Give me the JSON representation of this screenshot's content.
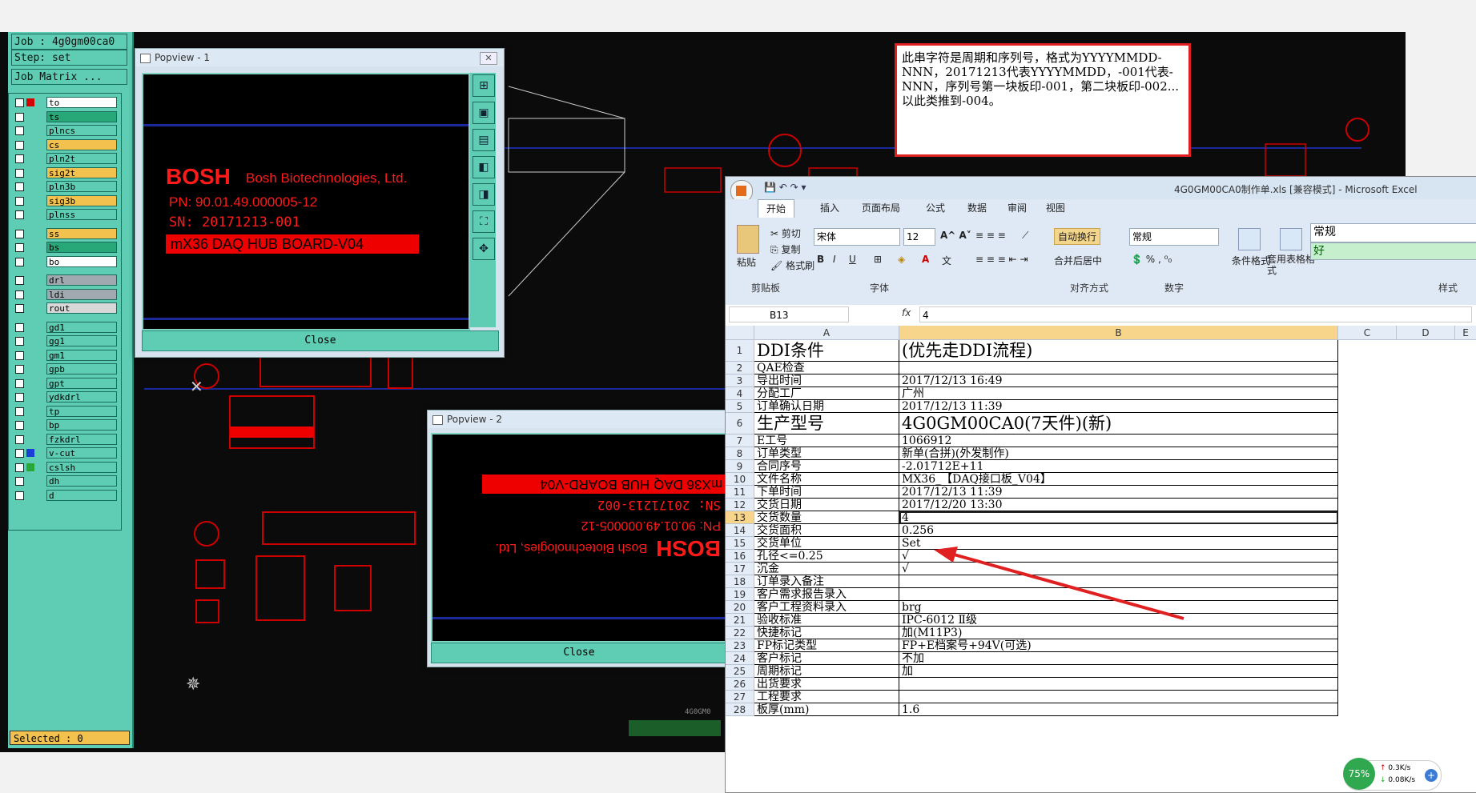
{
  "left_panel": {
    "job": "Job : 4g0gm00ca0",
    "step": "Step: set",
    "job_matrix": "Job Matrix ...",
    "selected": "Selected : 0",
    "layers": [
      {
        "name": "to",
        "color": "#ffffff",
        "swatch": "#d40000"
      },
      {
        "name": "ts",
        "color": "#28a878",
        "swatch": null
      },
      {
        "name": "plncs",
        "color": "#5ecdb3",
        "swatch": null
      },
      {
        "name": "cs",
        "color": "#f2c14e",
        "swatch": null
      },
      {
        "name": "pln2t",
        "color": "#5ecdb3",
        "swatch": null
      },
      {
        "name": "sig2t",
        "color": "#f2c14e",
        "swatch": null
      },
      {
        "name": "pln3b",
        "color": "#5ecdb3",
        "swatch": null
      },
      {
        "name": "sig3b",
        "color": "#f2c14e",
        "swatch": null
      },
      {
        "name": "plnss",
        "color": "#5ecdb3",
        "swatch": null
      },
      {
        "name": "ss",
        "color": "#f2c14e",
        "swatch": null
      },
      {
        "name": "bs",
        "color": "#28a878",
        "swatch": null
      },
      {
        "name": "bo",
        "color": "#ffffff",
        "swatch": null
      },
      {
        "name": "drl",
        "color": "#a0a8b0",
        "swatch": null
      },
      {
        "name": "ldi",
        "color": "#a0a8b0",
        "swatch": null
      },
      {
        "name": "rout",
        "color": "#d8d8d8",
        "swatch": null
      },
      {
        "name": "gd1",
        "color": "#5ecdb3",
        "swatch": null
      },
      {
        "name": "gg1",
        "color": "#5ecdb3",
        "swatch": null
      },
      {
        "name": "gm1",
        "color": "#5ecdb3",
        "swatch": null
      },
      {
        "name": "gpb",
        "color": "#5ecdb3",
        "swatch": null
      },
      {
        "name": "gpt",
        "color": "#5ecdb3",
        "swatch": null
      },
      {
        "name": "ydkdrl",
        "color": "#5ecdb3",
        "swatch": null
      },
      {
        "name": "tp",
        "color": "#5ecdb3",
        "swatch": null
      },
      {
        "name": "bp",
        "color": "#5ecdb3",
        "swatch": null
      },
      {
        "name": "fzkdrl",
        "color": "#5ecdb3",
        "swatch": null
      },
      {
        "name": "v-cut",
        "color": "#5ecdb3",
        "swatch": "#1a3fd4"
      },
      {
        "name": "cslsh",
        "color": "#5ecdb3",
        "swatch": "#28a838"
      },
      {
        "name": "dh",
        "color": "#5ecdb3",
        "swatch": null
      },
      {
        "name": "d",
        "color": "#5ecdb3",
        "swatch": null
      }
    ]
  },
  "popview1": {
    "title": "Popview - 1",
    "close": "Close",
    "brand": "BOSH",
    "company": "Bosh Biotechnologies, Ltd.",
    "pn": "PN: 90.01.49.000005-12",
    "sn": "SN: 20171213-001",
    "board": "mX36 DAQ HUB BOARD-V04"
  },
  "popview2": {
    "title": "Popview - 2",
    "close": "Close",
    "board": "mX36 DAQ HUB BOARD-V04",
    "sn": "SN: 20171213-002",
    "pn": "PN: 90.01.49.000005-12",
    "company": "Bosh Biotechnologies, Ltd.",
    "brand": "BOSH"
  },
  "note": "此串字符是周期和序列号，格式为YYYYMMDD-NNN，20171213代表YYYYMMDD，-001代表-NNN，序列号第一块板印-001，第二块板印-002...以此类推到-004。",
  "excel": {
    "title": "4G0GM00CA0制作单.xls [兼容模式] - Microsoft Excel",
    "tabs": [
      "开始",
      "插入",
      "页面布局",
      "公式",
      "数据",
      "审阅",
      "视图"
    ],
    "clipboard": {
      "paste": "粘贴",
      "cut": "剪切",
      "copy": "复制",
      "format_painter": "格式刷",
      "label": "剪贴板"
    },
    "font": {
      "name": "宋体",
      "size": "12",
      "label": "字体"
    },
    "align": {
      "wrap": "自动换行",
      "merge": "合并后居中",
      "label": "对齐方式"
    },
    "number": {
      "format": "常规",
      "label": "数字"
    },
    "styles": {
      "cond": "条件格式",
      "table": "套用表格格式",
      "normal": "常规",
      "good": "好",
      "label": "样式"
    },
    "namebox": "B13",
    "fx": "fx",
    "formula_value": "4",
    "columns": [
      "A",
      "B",
      "C",
      "D",
      "E"
    ],
    "rows": [
      {
        "n": "1",
        "a": "DDI条件",
        "b": "(优先走DDI流程)",
        "big": true
      },
      {
        "n": "2",
        "a": "QAE检查",
        "b": ""
      },
      {
        "n": "3",
        "a": "导出时间",
        "b": "2017/12/13 16:49"
      },
      {
        "n": "4",
        "a": "分配工厂",
        "b": "广州"
      },
      {
        "n": "5",
        "a": "订单确认日期",
        "b": "2017/12/13 11:39"
      },
      {
        "n": "6",
        "a": "生产型号",
        "b": "4G0GM00CA0(7天件)(新)",
        "big": true
      },
      {
        "n": "7",
        "a": "E工号",
        "b": "1066912"
      },
      {
        "n": "8",
        "a": "订单类型",
        "b": "新单(合拼)(外发制作)"
      },
      {
        "n": "9",
        "a": "合同序号",
        "b": "-2.01712E+11"
      },
      {
        "n": "10",
        "a": "文件名称",
        "b": "MX36_【DAQ接口板_V04】"
      },
      {
        "n": "11",
        "a": "下单时间",
        "b": "2017/12/13 11:39"
      },
      {
        "n": "12",
        "a": "交货日期",
        "b": "2017/12/20 13:30"
      },
      {
        "n": "13",
        "a": "交货数量",
        "b": "4"
      },
      {
        "n": "14",
        "a": "交货面积",
        "b": "0.256"
      },
      {
        "n": "15",
        "a": "交货单位",
        "b": "Set"
      },
      {
        "n": "16",
        "a": "孔径<=0.25",
        "b": "√"
      },
      {
        "n": "17",
        "a": "沉金",
        "b": "√"
      },
      {
        "n": "18",
        "a": "订单录入备注",
        "b": ""
      },
      {
        "n": "19",
        "a": "客户需求报告录入",
        "b": ""
      },
      {
        "n": "20",
        "a": "客户工程资料录入",
        "b": "brg"
      },
      {
        "n": "21",
        "a": "验收标准",
        "b": "IPC-6012 Ⅱ级"
      },
      {
        "n": "22",
        "a": "快捷标记",
        "b": "加(M11P3)"
      },
      {
        "n": "23",
        "a": "FP标记类型",
        "b": "FP+E档案号+94V(可选)"
      },
      {
        "n": "24",
        "a": "客户标记",
        "b": "不加"
      },
      {
        "n": "25",
        "a": "周期标记",
        "b": "加"
      },
      {
        "n": "26",
        "a": "出货要求",
        "b": ""
      },
      {
        "n": "27",
        "a": "工程要求",
        "b": ""
      },
      {
        "n": "28",
        "a": "板厚(mm)",
        "b": "1.6"
      }
    ]
  },
  "netwidget": {
    "percent": "75%",
    "up": "0.3K/s",
    "down": "0.08K/s"
  },
  "board_code": "4G0GM0"
}
